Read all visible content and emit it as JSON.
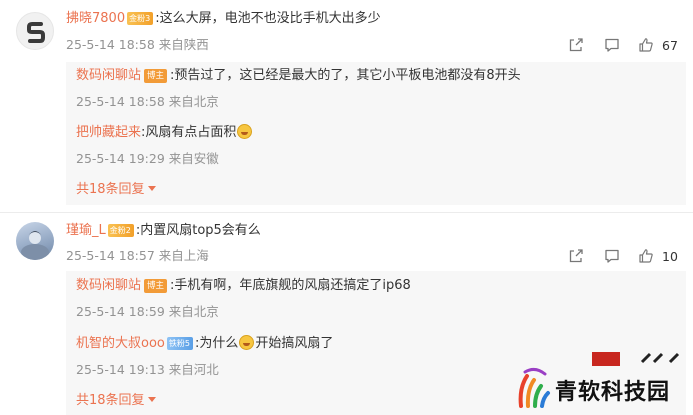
{
  "comments": [
    {
      "username": "拂晓7800",
      "badge": "金粉3",
      "text": ":这么大屏，电池不也没比手机大出多少",
      "time": "25-5-14 18:58",
      "location": "来自陕西",
      "likes": "67",
      "replies": [
        {
          "username": "数码闲聊站",
          "host_badge": "博主",
          "text": ":预告过了，这已经是最大的了，其它小平板电池都没有8开头",
          "time": "25-5-14 18:58",
          "location": "来自北京"
        },
        {
          "username": "把帅藏起来",
          "text": ":风扇有点占面积",
          "time": "25-5-14 19:29",
          "location": "来自安徽",
          "emoji": "laughing-crying-emoji"
        }
      ],
      "more_label": "共18条回复"
    },
    {
      "username": "瑾瑜_L",
      "badge": "金粉2",
      "text": ":内置风扇top5会有么",
      "time": "25-5-14 18:57",
      "location": "来自上海",
      "likes": "10",
      "replies": [
        {
          "username": "数码闲聊站",
          "host_badge": "博主",
          "text": ":手机有啊，年底旗舰的风扇还搞定了ip68",
          "time": "25-5-14 18:59",
          "location": "来自北京"
        },
        {
          "username": "机智的大叔ooo",
          "badge": "铁粉5",
          "text_before": ":为什么",
          "text_after": "开始搞风扇了",
          "time": "25-5-14 19:13",
          "location": "来自河北",
          "emoji": "grinning-sweat-emoji"
        }
      ],
      "more_label": "共18条回复"
    }
  ],
  "watermark": {
    "text": "青软科技园"
  },
  "colors": {
    "username": "#eb7350",
    "meta": "#939393",
    "reply_bg": "#f7f7f7",
    "badge_gold": "#f2a02a",
    "badge_blue": "#5a9fe6",
    "host_badge": "#f29b38"
  }
}
